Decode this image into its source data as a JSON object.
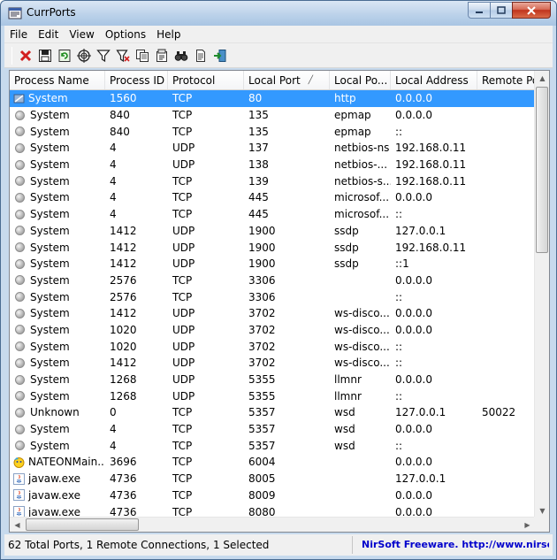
{
  "window": {
    "title": "CurrPorts"
  },
  "menu": [
    "File",
    "Edit",
    "View",
    "Options",
    "Help"
  ],
  "toolbar": [
    "close-connections-icon",
    "save-icon",
    "refresh-icon",
    "properties-target-icon",
    "filter-icon",
    "clear-filter-icon",
    "copy-icon",
    "html-report-icon",
    "find-icon",
    "text-report-icon",
    "exit-icon"
  ],
  "columns": [
    "Process Name",
    "Process ID",
    "Protocol",
    "Local Port",
    "Local Po...",
    "Local Address",
    "Remote Por"
  ],
  "rows": [
    {
      "name": "System",
      "pid": "1560",
      "proto": "TCP",
      "port": "80",
      "pname": "http",
      "addr": "0.0.0.0",
      "rport": "",
      "icon": "system",
      "selected": true
    },
    {
      "name": "System",
      "pid": "840",
      "proto": "TCP",
      "port": "135",
      "pname": "epmap",
      "addr": "0.0.0.0",
      "rport": "",
      "icon": "dot"
    },
    {
      "name": "System",
      "pid": "840",
      "proto": "TCP",
      "port": "135",
      "pname": "epmap",
      "addr": "::",
      "rport": "",
      "icon": "dot"
    },
    {
      "name": "System",
      "pid": "4",
      "proto": "UDP",
      "port": "137",
      "pname": "netbios-ns",
      "addr": "192.168.0.11",
      "rport": "",
      "icon": "dot"
    },
    {
      "name": "System",
      "pid": "4",
      "proto": "UDP",
      "port": "138",
      "pname": "netbios-...",
      "addr": "192.168.0.11",
      "rport": "",
      "icon": "dot"
    },
    {
      "name": "System",
      "pid": "4",
      "proto": "TCP",
      "port": "139",
      "pname": "netbios-s...",
      "addr": "192.168.0.11",
      "rport": "",
      "icon": "dot"
    },
    {
      "name": "System",
      "pid": "4",
      "proto": "TCP",
      "port": "445",
      "pname": "microsof...",
      "addr": "0.0.0.0",
      "rport": "",
      "icon": "dot"
    },
    {
      "name": "System",
      "pid": "4",
      "proto": "TCP",
      "port": "445",
      "pname": "microsof...",
      "addr": "::",
      "rport": "",
      "icon": "dot"
    },
    {
      "name": "System",
      "pid": "1412",
      "proto": "UDP",
      "port": "1900",
      "pname": "ssdp",
      "addr": "127.0.0.1",
      "rport": "",
      "icon": "dot"
    },
    {
      "name": "System",
      "pid": "1412",
      "proto": "UDP",
      "port": "1900",
      "pname": "ssdp",
      "addr": "192.168.0.11",
      "rport": "",
      "icon": "dot"
    },
    {
      "name": "System",
      "pid": "1412",
      "proto": "UDP",
      "port": "1900",
      "pname": "ssdp",
      "addr": "::1",
      "rport": "",
      "icon": "dot"
    },
    {
      "name": "System",
      "pid": "2576",
      "proto": "TCP",
      "port": "3306",
      "pname": "",
      "addr": "0.0.0.0",
      "rport": "",
      "icon": "dot"
    },
    {
      "name": "System",
      "pid": "2576",
      "proto": "TCP",
      "port": "3306",
      "pname": "",
      "addr": "::",
      "rport": "",
      "icon": "dot"
    },
    {
      "name": "System",
      "pid": "1412",
      "proto": "UDP",
      "port": "3702",
      "pname": "ws-disco...",
      "addr": "0.0.0.0",
      "rport": "",
      "icon": "dot"
    },
    {
      "name": "System",
      "pid": "1020",
      "proto": "UDP",
      "port": "3702",
      "pname": "ws-disco...",
      "addr": "0.0.0.0",
      "rport": "",
      "icon": "dot"
    },
    {
      "name": "System",
      "pid": "1020",
      "proto": "UDP",
      "port": "3702",
      "pname": "ws-disco...",
      "addr": "::",
      "rport": "",
      "icon": "dot"
    },
    {
      "name": "System",
      "pid": "1412",
      "proto": "UDP",
      "port": "3702",
      "pname": "ws-disco...",
      "addr": "::",
      "rport": "",
      "icon": "dot"
    },
    {
      "name": "System",
      "pid": "1268",
      "proto": "UDP",
      "port": "5355",
      "pname": "llmnr",
      "addr": "0.0.0.0",
      "rport": "",
      "icon": "dot"
    },
    {
      "name": "System",
      "pid": "1268",
      "proto": "UDP",
      "port": "5355",
      "pname": "llmnr",
      "addr": "::",
      "rport": "",
      "icon": "dot"
    },
    {
      "name": "Unknown",
      "pid": "0",
      "proto": "TCP",
      "port": "5357",
      "pname": "wsd",
      "addr": "127.0.0.1",
      "rport": "50022",
      "icon": "dot"
    },
    {
      "name": "System",
      "pid": "4",
      "proto": "TCP",
      "port": "5357",
      "pname": "wsd",
      "addr": "0.0.0.0",
      "rport": "",
      "icon": "dot"
    },
    {
      "name": "System",
      "pid": "4",
      "proto": "TCP",
      "port": "5357",
      "pname": "wsd",
      "addr": "::",
      "rport": "",
      "icon": "dot"
    },
    {
      "name": "NATEONMain....",
      "pid": "3696",
      "proto": "TCP",
      "port": "6004",
      "pname": "",
      "addr": "0.0.0.0",
      "rport": "",
      "icon": "nateon"
    },
    {
      "name": "javaw.exe",
      "pid": "4736",
      "proto": "TCP",
      "port": "8005",
      "pname": "",
      "addr": "127.0.0.1",
      "rport": "",
      "icon": "java"
    },
    {
      "name": "javaw.exe",
      "pid": "4736",
      "proto": "TCP",
      "port": "8009",
      "pname": "",
      "addr": "0.0.0.0",
      "rport": "",
      "icon": "java"
    },
    {
      "name": "javaw.exe",
      "pid": "4736",
      "proto": "TCP",
      "port": "8080",
      "pname": "",
      "addr": "0.0.0.0",
      "rport": "",
      "icon": "java"
    }
  ],
  "status": {
    "summary": "62 Total Ports, 1 Remote Connections, 1 Selected",
    "link": "NirSoft Freeware.  http://www.nirsoft.net"
  },
  "colors": {
    "selection": "#3399ff",
    "link": "#0000cc"
  }
}
